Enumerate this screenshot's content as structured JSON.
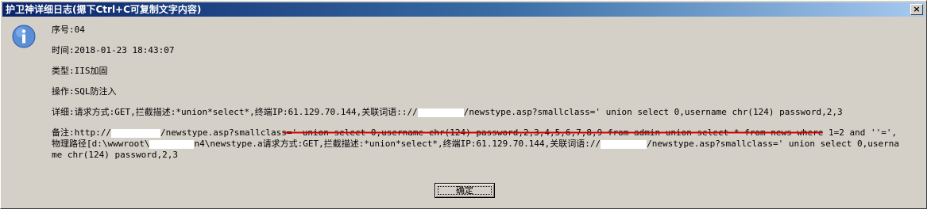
{
  "window": {
    "title": "护卫神详细日志(摁下Ctrl+C可复制文字内容)",
    "close_glyph": "×"
  },
  "icon": "info-icon",
  "fields": {
    "seq": "序号:04",
    "time": "时间:2018-01-23 18:43:07",
    "type": "类型:IIS加固",
    "action": "操作:SQL防注入",
    "detail_a": "详细:请求方式:GET,拦截描述:*union*select*,终端IP:61.129.70.144,关联词语:://",
    "detail_b": "/newstype.asp?smallclass=' union select 0,username chr(124) password,2,3"
  },
  "remark": {
    "p1": "备注:http://",
    "p2": "/newstype.asp?smallclass=' union select 0,username chr(124) password,2,3,4,5,6,7,8,9 from admin union select * from news where 1=2 and ''=',物理路径[d:\\wwwroot\\",
    "p3": "n4\\newstype.a请求方式:GET,拦截描述:*union*select*,终端IP:61.129.70.144,关联词语://",
    "p4": "/newstype.asp?smallclass=' union select 0,username chr(124) password,2,3"
  },
  "buttons": {
    "ok": "确定"
  },
  "colors": {
    "underline": "#cc0000",
    "titlebar_start": "#0a246a",
    "titlebar_end": "#a6caf0"
  }
}
